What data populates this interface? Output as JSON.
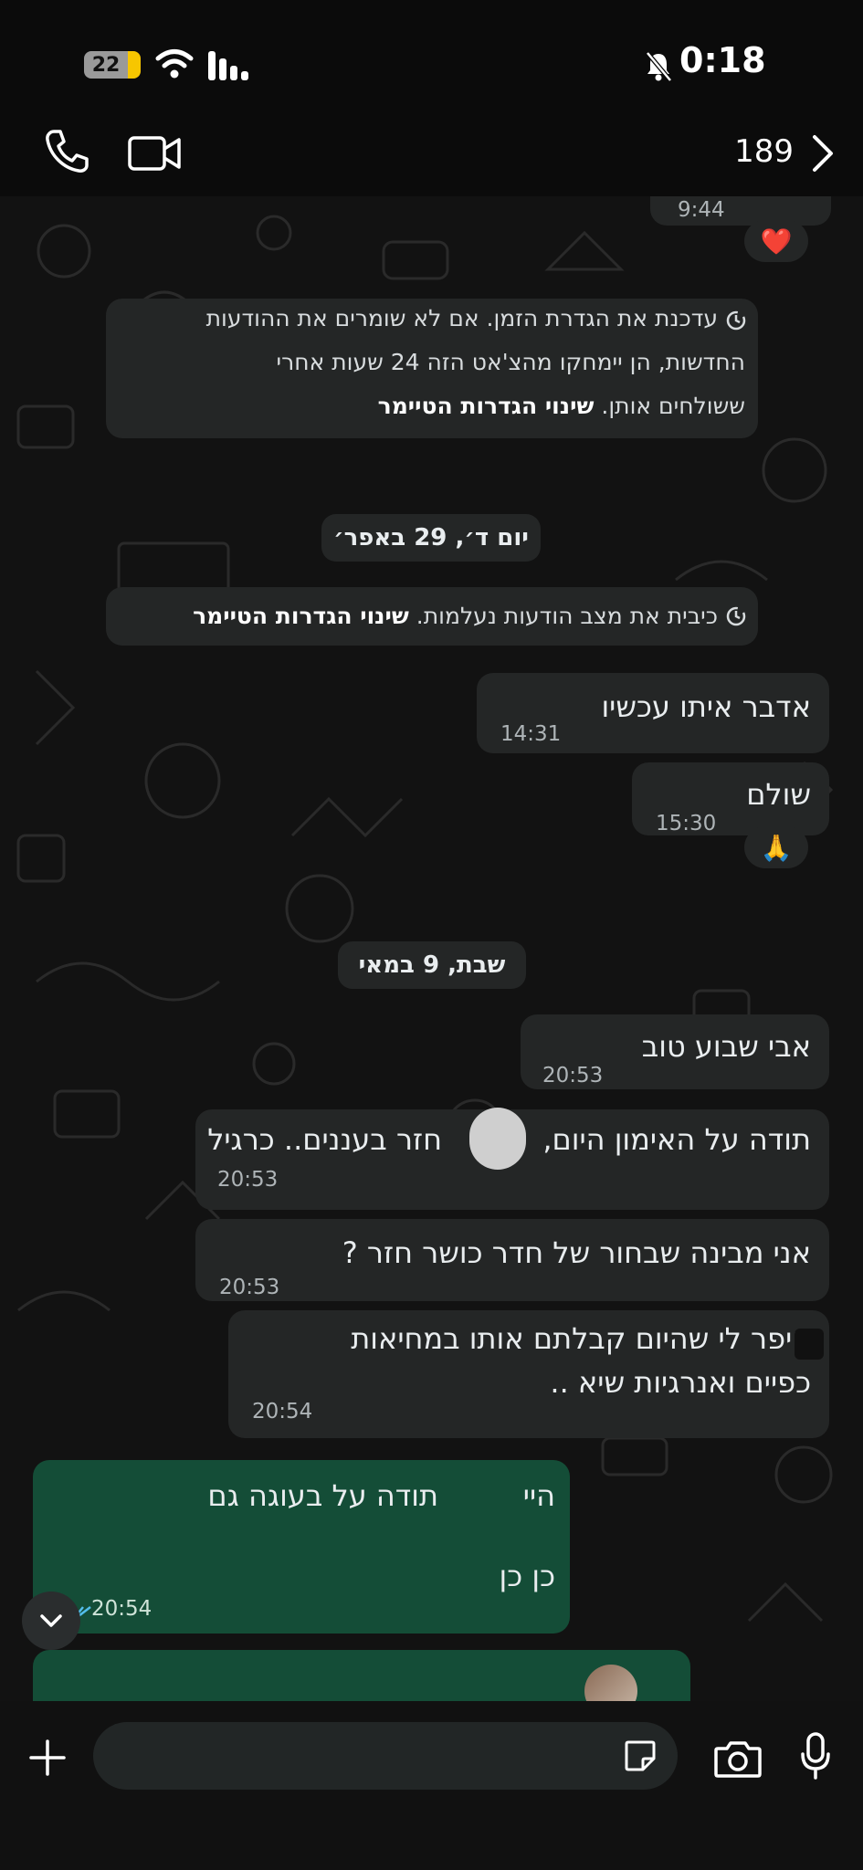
{
  "status_bar": {
    "battery": "22",
    "time": "0:18"
  },
  "header": {
    "unread_count": "189"
  },
  "messages": {
    "top_partial_time": "9:44",
    "heart_reaction": "❤️",
    "sys1_line1": "עדכנת את הגדרת הזמן. אם לא שומרים את ההודעות",
    "sys1_line2": "החדשות, הן יימחקו מהצ'אט הזה 24 שעות אחרי",
    "sys1_line3": "ששולחים אותן.",
    "sys1_link": "שינוי הגדרות הטיימר",
    "date1": "יום ד׳, 29 באפר׳",
    "sys2_text": "כיבית את מצב הודעות נעלמות.",
    "sys2_link": "שינוי הגדרות הטיימר",
    "m1_text": "אדבר איתו עכשיו",
    "m1_time": "14:31",
    "m2_text": "שולם",
    "m2_time": "15:30",
    "pray_reaction": "🙏",
    "date2": "שבת, 9 במאי",
    "m3_text": "אבי שבוע טוב",
    "m3_time": "20:53",
    "m4_text_a": "תודה על האימון היום,",
    "m4_text_b": "חזר בעננים.. כרגיל",
    "m4_time": "20:53",
    "m5_text": "אני מבינה שבחור של חדר כושר חזר ?",
    "m5_time": "20:53",
    "m6_line1": "סיפר לי שהיום קבלתם אותו במחיאות",
    "m6_line2": "כפיים ואנרגיות שיא ..",
    "m6_time": "20:54",
    "m7_line1_a": "היי",
    "m7_line1_b": "תודה על בעוגה גם",
    "m7_line2": "כן כן",
    "m7_time": "20:54"
  },
  "colors": {
    "outgoing": "#144d37",
    "incoming": "#242626",
    "background": "#121212"
  }
}
